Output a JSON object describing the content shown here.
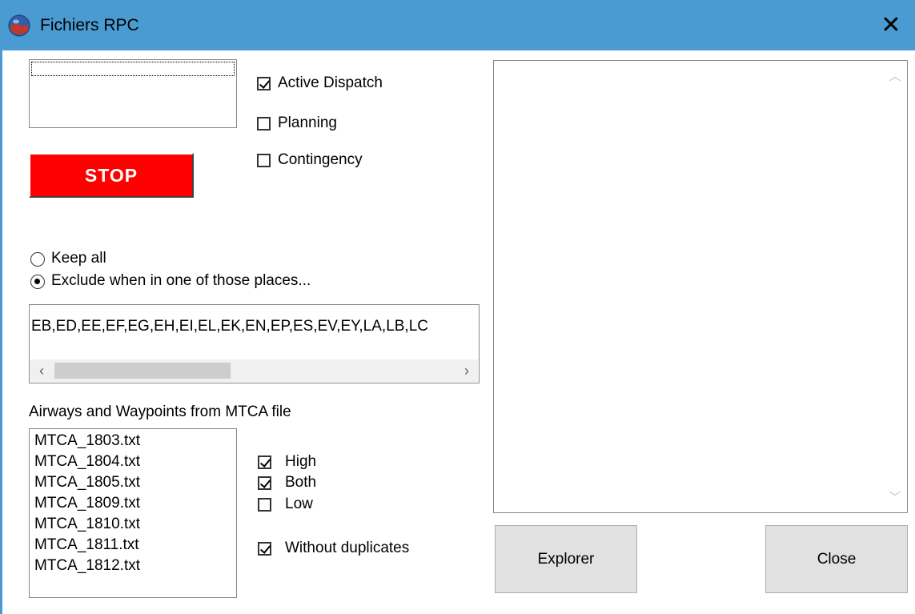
{
  "window": {
    "title": "Fichiers RPC",
    "close_glyph": "✕",
    "icon": "globe-app-icon"
  },
  "stop_button": {
    "label": "STOP",
    "color": "#ff0000"
  },
  "modes": [
    {
      "label": "Active Dispatch",
      "checked": true
    },
    {
      "label": "Planning",
      "checked": false
    },
    {
      "label": "Contingency",
      "checked": false
    }
  ],
  "filter": {
    "options": [
      {
        "label": "Keep all",
        "selected": false
      },
      {
        "label": "Exclude when in one of those places...",
        "selected": true
      }
    ],
    "places_value": "EB,ED,EE,EF,EG,EH,EI,EL,EK,EN,EP,ES,EV,EY,LA,LB,LC"
  },
  "scroll_arrows": {
    "left": "‹",
    "right": "›",
    "up": "︿",
    "down": "﹀"
  },
  "mtca": {
    "label": "Airways and Waypoints from MTCA file",
    "files": [
      "MTCA_1803.txt",
      "MTCA_1804.txt",
      "MTCA_1805.txt",
      "MTCA_1809.txt",
      "MTCA_1810.txt",
      "MTCA_1811.txt",
      "MTCA_1812.txt"
    ]
  },
  "levels": [
    {
      "label": "High",
      "checked": true
    },
    {
      "label": "Both",
      "checked": true
    },
    {
      "label": "Low",
      "checked": false
    }
  ],
  "without_duplicates": {
    "label": "Without duplicates",
    "checked": true
  },
  "buttons": {
    "explorer": "Explorer",
    "close": "Close"
  },
  "colors": {
    "titlebar": "#4a9bd1",
    "stop": "#ff0000"
  }
}
